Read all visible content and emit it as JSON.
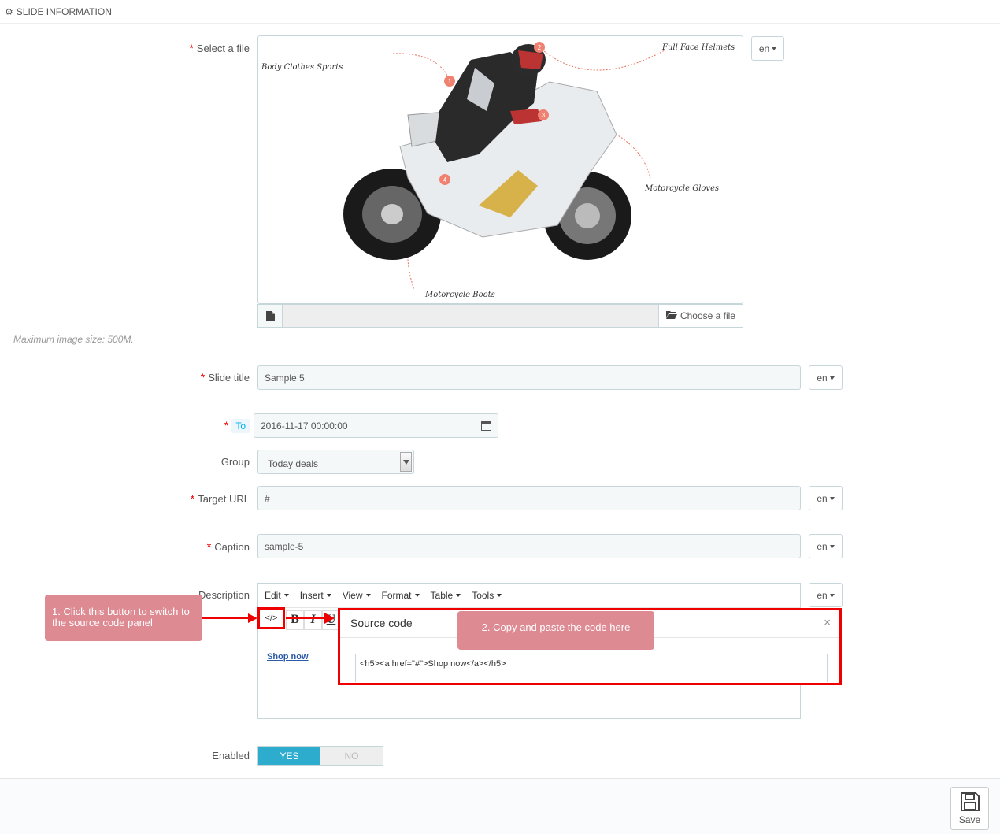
{
  "panel": {
    "title": "SLIDE INFORMATION",
    "icon": "cogs-icon"
  },
  "labels": {
    "select_file": "Select a file",
    "slide_title": "Slide title",
    "to": "To",
    "group": "Group",
    "target_url": "Target URL",
    "caption": "Caption",
    "description": "Description",
    "enabled": "Enabled"
  },
  "required_mark": "*",
  "image": {
    "annotations": [
      "Body Clothes Sports",
      "Full Face Helmets",
      "Motorcycle Gloves",
      "Motorcycle Boots"
    ],
    "markers": [
      "1",
      "2",
      "3",
      "4"
    ]
  },
  "file": {
    "choose_label": "Choose a file",
    "hint": "Maximum image size: 500M."
  },
  "lang": "en",
  "fields": {
    "slide_title": "Sample 5",
    "to_date": "2016-11-17 00:00:00",
    "group": "Today deals",
    "target_url": "#",
    "caption": "sample-5"
  },
  "editor": {
    "menus": [
      "Edit",
      "Insert",
      "View",
      "Format",
      "Table",
      "Tools"
    ],
    "toolbar": [
      "</>",
      "B",
      "I",
      "U"
    ],
    "content_link": "Shop now"
  },
  "source_code": {
    "title": "Source code",
    "close": "×",
    "code": "<h5><a href=\"#\">Shop now</a></h5>"
  },
  "callouts": {
    "step1": "1. Click this button to switch to the source code panel",
    "step2": "2. Copy and paste the code here"
  },
  "toggle": {
    "yes": "YES",
    "no": "NO"
  },
  "save_label": "Save",
  "colors": {
    "accent": "#2eacce",
    "callout": "#dd8a93",
    "highlight": "#ee0000",
    "required": "#ee0000"
  }
}
